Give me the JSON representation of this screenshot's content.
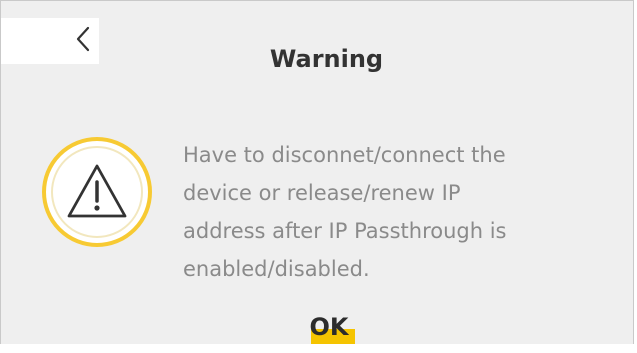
{
  "dialog": {
    "title": "Warning",
    "message": "Have to disconnet/connect the\ndevice or release/renew IP\naddress after IP Passthrough is\nenabled/disabled.",
    "ok_label": "OK"
  },
  "icons": {
    "back": "chevron-left-icon",
    "warning": "warning-triangle-icon"
  },
  "colors": {
    "accent": "#f5c400",
    "dialog_background": "#efefef",
    "message_text": "#8a8a8a",
    "title_text": "#333333"
  }
}
